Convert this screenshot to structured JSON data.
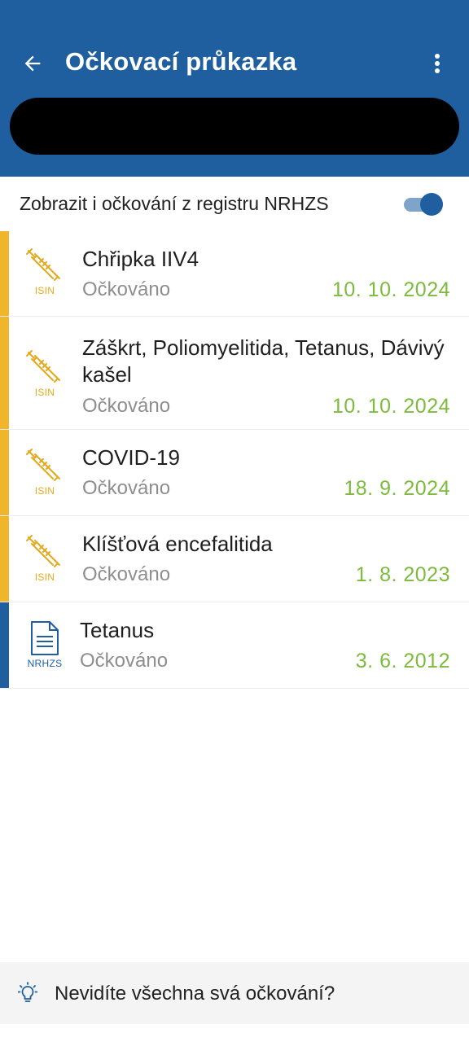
{
  "header": {
    "title": "Očkovací průkazka",
    "back_icon": "arrow-left-icon",
    "menu_icon": "more-vertical-icon",
    "background_color": "#1f5f9f"
  },
  "toggle": {
    "label": "Zobrazit i očkování z registru NRHZS",
    "checked": true
  },
  "vaccinations": [
    {
      "name": "Chřipka IIV4",
      "status": "Očkováno",
      "date": "10. 10. 2024",
      "source": "ISIN",
      "icon": "syringe-icon"
    },
    {
      "name": "Záškrt, Poliomyelitida, Tetanus, Dávivý kašel",
      "status": "Očkováno",
      "date": "10. 10. 2024",
      "source": "ISIN",
      "icon": "syringe-icon"
    },
    {
      "name": "COVID-19",
      "status": "Očkováno",
      "date": "18. 9. 2024",
      "source": "ISIN",
      "icon": "syringe-icon"
    },
    {
      "name": "Klíšťová encefalitida",
      "status": "Očkováno",
      "date": "1. 8. 2023",
      "source": "ISIN",
      "icon": "syringe-icon"
    },
    {
      "name": "Tetanus",
      "status": "Očkováno",
      "date": "3. 6. 2012",
      "source": "NRHZS",
      "icon": "document-icon"
    }
  ],
  "colors": {
    "isin_accent": "#f0b52a",
    "nrhzs_accent": "#1f5f9f",
    "date_green": "#7cbb3c"
  },
  "bottom_banner": {
    "text": "Nevidíte všechna svá očkování?",
    "icon": "lightbulb-icon"
  }
}
